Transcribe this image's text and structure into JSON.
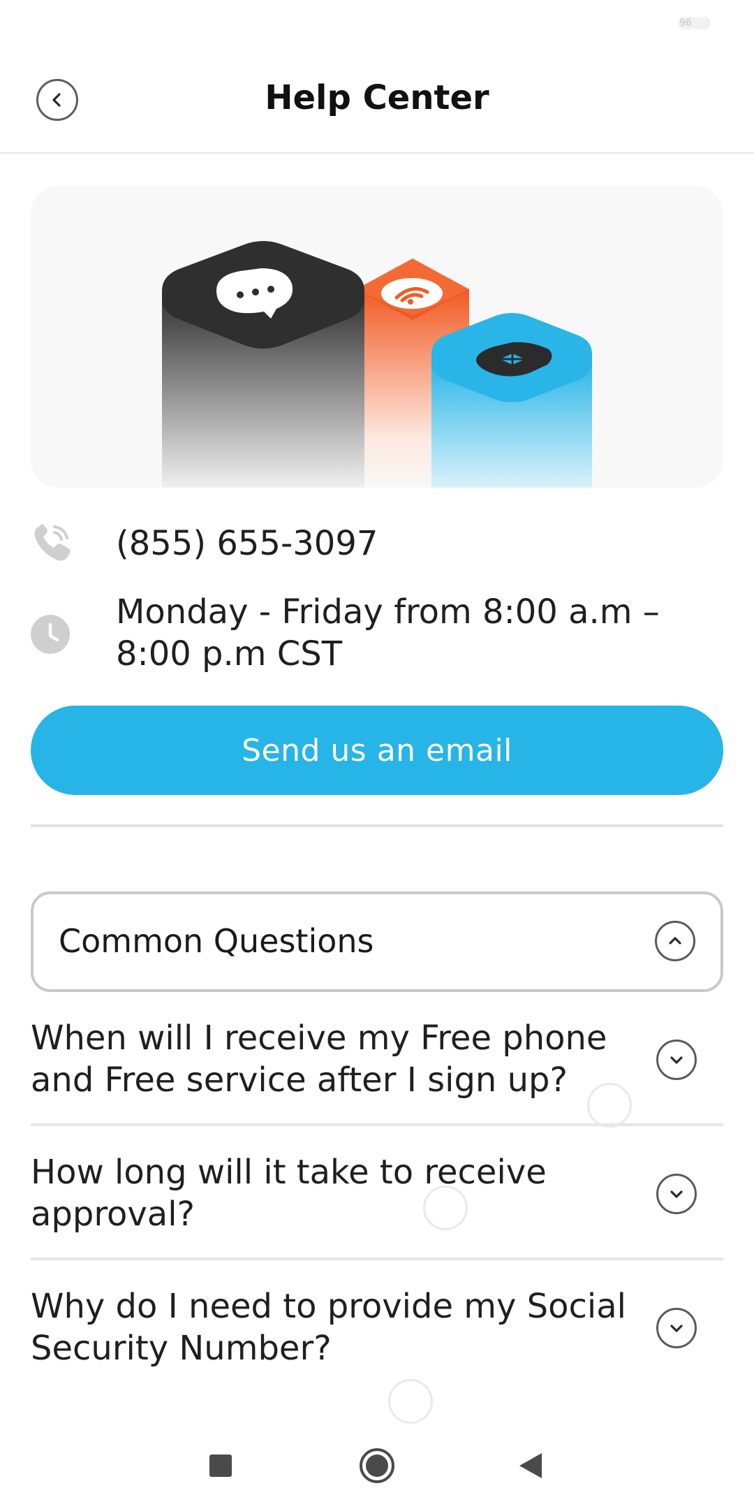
{
  "status_bar": {
    "battery_level": "96"
  },
  "header": {
    "title": "Help Center"
  },
  "contact": {
    "phone": "(855) 655-3097",
    "hours": "Monday - Friday from 8:00 a.m – 8:00 p.m CST"
  },
  "email_button": {
    "label": "Send us an email"
  },
  "faq": {
    "section_title": "Common Questions",
    "section_expanded": true,
    "items": [
      {
        "question": "When will I receive my Free phone and Free service after I sign up?"
      },
      {
        "question": "How long will it take to receive approval?"
      },
      {
        "question": "Why do I need to provide my Social Security Number?"
      }
    ]
  },
  "icons": {
    "back": "chevron-left-icon",
    "phone": "phone-icon",
    "clock": "clock-icon",
    "expand": "chevron-down-icon",
    "collapse": "chevron-up-icon"
  },
  "colors": {
    "primary": "#27b4e6",
    "dark_block": "#2f2f2f",
    "orange_block": "#f25a23",
    "blue_block": "#27b4e6",
    "icon_gray": "#cfcfcf"
  }
}
